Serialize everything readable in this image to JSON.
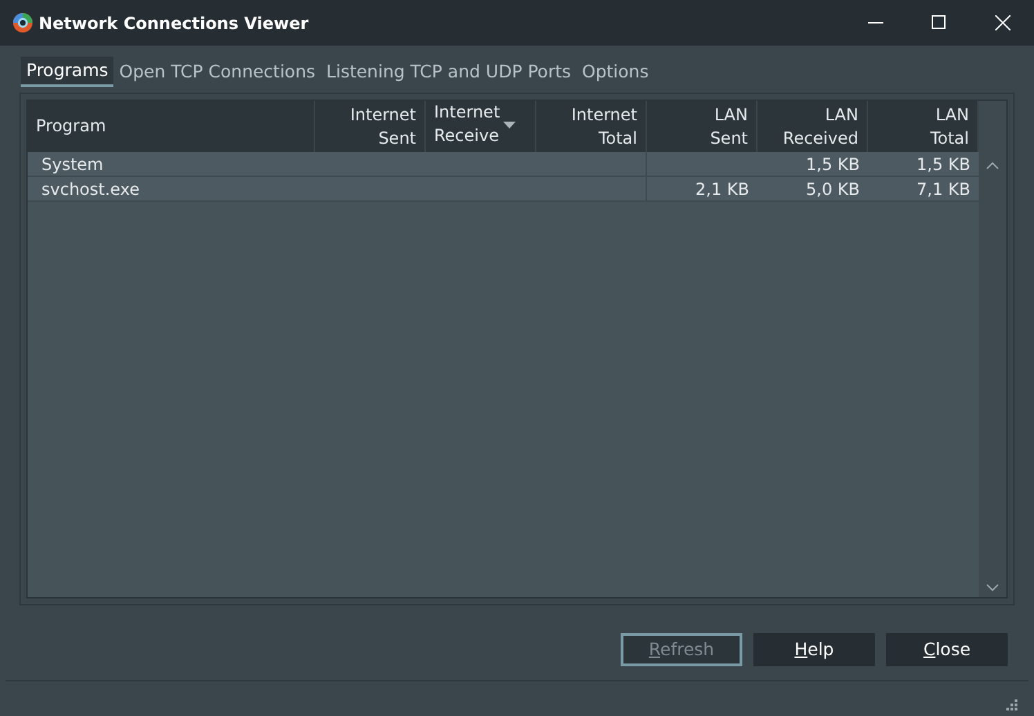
{
  "window": {
    "title": "Network Connections Viewer"
  },
  "tabs": [
    {
      "label": "Programs",
      "selected": true
    },
    {
      "label": "Open TCP Connections",
      "selected": false
    },
    {
      "label": "Listening TCP and UDP Ports",
      "selected": false
    },
    {
      "label": "Options",
      "selected": false
    }
  ],
  "table": {
    "columns": [
      {
        "lines": [
          "Program"
        ],
        "sorted": false
      },
      {
        "lines": [
          "Internet",
          "Sent"
        ],
        "sorted": false
      },
      {
        "lines": [
          "Internet",
          "Receive"
        ],
        "sorted": true
      },
      {
        "lines": [
          "Internet",
          "Total"
        ],
        "sorted": false
      },
      {
        "lines": [
          "LAN",
          "Sent"
        ],
        "sorted": false
      },
      {
        "lines": [
          "LAN",
          "Received"
        ],
        "sorted": false
      },
      {
        "lines": [
          "LAN",
          "Total"
        ],
        "sorted": false
      }
    ],
    "rows": [
      [
        "System",
        "",
        "",
        "",
        "",
        "1,5 KB",
        "1,5 KB"
      ],
      [
        "svchost.exe",
        "",
        "",
        "",
        "2,1 KB",
        "5,0 KB",
        "7,1 KB"
      ]
    ]
  },
  "buttons": [
    {
      "mnemonic": "R",
      "rest": "efresh",
      "disabled": true
    },
    {
      "mnemonic": "H",
      "rest": "elp",
      "disabled": false
    },
    {
      "mnemonic": "C",
      "rest": "lose",
      "disabled": false
    }
  ]
}
